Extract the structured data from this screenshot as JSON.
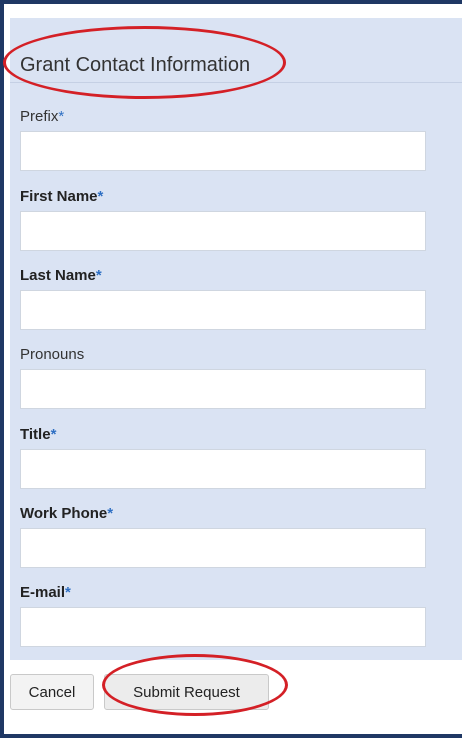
{
  "panel": {
    "title": "Grant Contact Information"
  },
  "fields": [
    {
      "label": "Prefix",
      "required": "*",
      "value": ""
    },
    {
      "label": "First Name",
      "required": "*",
      "value": ""
    },
    {
      "label": "Last Name",
      "required": "*",
      "value": ""
    },
    {
      "label": "Pronouns",
      "required": "",
      "value": ""
    },
    {
      "label": "Title",
      "required": "*",
      "value": ""
    },
    {
      "label": "Work Phone",
      "required": "*",
      "value": ""
    },
    {
      "label": "E-mail",
      "required": "*",
      "value": ""
    }
  ],
  "buttons": {
    "cancel_label": "Cancel",
    "submit_label": "Submit Request"
  },
  "colors": {
    "panel_background": "#dae3f3",
    "frame_border": "#1f3864",
    "required_marker": "#2e6fc3",
    "highlight": "#d42026"
  }
}
